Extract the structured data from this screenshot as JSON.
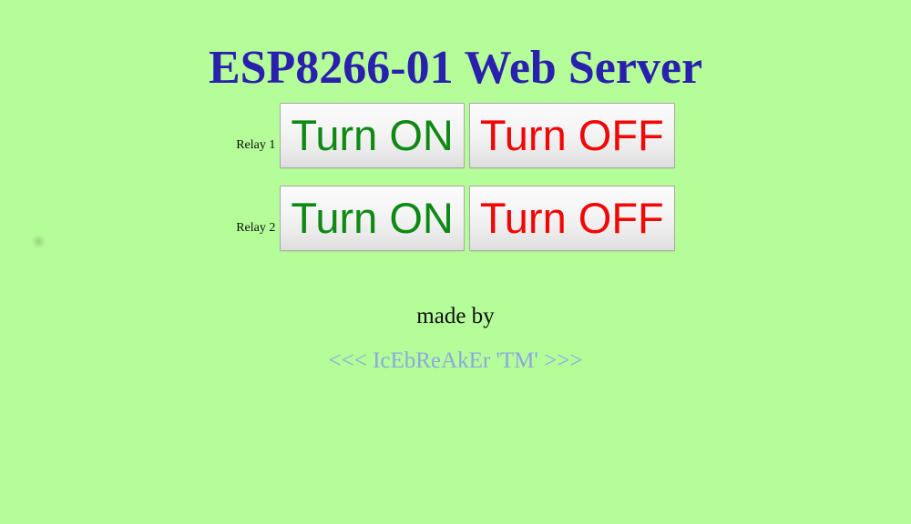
{
  "page": {
    "title": "ESP8266-01 Web Server",
    "background_color": "#b5fd99",
    "title_color": "#2a20ae"
  },
  "relays": [
    {
      "label": "Relay 1",
      "on_label": "Turn ON",
      "off_label": "Turn OFF",
      "on_color": "#0e8a14",
      "off_color": "#f20606"
    },
    {
      "label": "Relay 2",
      "on_label": "Turn ON",
      "off_label": "Turn OFF",
      "on_color": "#0e8a14",
      "off_color": "#f20606"
    }
  ],
  "footer": {
    "made_by_label": "made by",
    "credit_link": "<<< IcEbReAkEr 'TM' >>>",
    "credit_link_color": "#8ba8e0"
  }
}
